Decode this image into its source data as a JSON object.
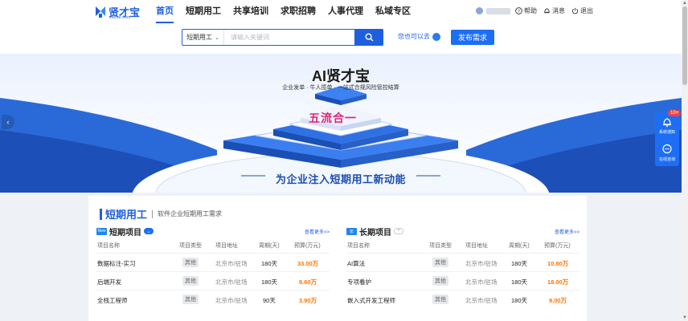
{
  "brand": {
    "name": "贤才宝",
    "domain": "xiecai.com",
    "primary": "#1e5fe0",
    "price_color": "#ff7300"
  },
  "nav": [
    {
      "label": "首页",
      "active": true
    },
    {
      "label": "短期用工"
    },
    {
      "label": "共享培训"
    },
    {
      "label": "求职招聘"
    },
    {
      "label": "人事代理"
    },
    {
      "label": "私域专区"
    }
  ],
  "user_menu": {
    "help": "帮助",
    "messages": "消息",
    "logout": "退出"
  },
  "search": {
    "category": "短期用工",
    "placeholder": "请输入关键词",
    "ask_label": "您也可以去",
    "publish_label": "发布需求"
  },
  "banner": {
    "title": "AI贤才宝",
    "subtitle": "企业发单 · 牛人揽单 · 一站式合规风险管控结算",
    "center_text": "五流合一",
    "slogan": "为企业注入短期用工新动能"
  },
  "side_float": {
    "badge": "10+",
    "notify_label": "系统通知",
    "consult_label": "在线咨询"
  },
  "section": {
    "title": "短期用工",
    "desc": "软件企业短期用工需求",
    "short": {
      "badge": "New",
      "title": "短期项目",
      "more": "查看更多>>",
      "headers": [
        "项目名称",
        "项目类型",
        "项目地址",
        "周期(天)",
        "预算(万元)"
      ],
      "rows": [
        {
          "name": "数据标注-实习",
          "type": "其他",
          "location": "北京市/驻场",
          "period": "180天",
          "budget": "33.00万"
        },
        {
          "name": "后端开发",
          "type": "其他",
          "location": "北京市/驻场",
          "period": "180天",
          "budget": "9.60万"
        },
        {
          "name": "全栈工程师",
          "type": "其他",
          "location": "北京市/驻场",
          "period": "90天",
          "budget": "3.90万"
        }
      ]
    },
    "long": {
      "badge": "长",
      "title": "长期项目",
      "more": "查看更多>>",
      "headers": [
        "项目名称",
        "项目类型",
        "项目地址",
        "周期(天)",
        "预算(万元)"
      ],
      "rows": [
        {
          "name": "AI算法",
          "type": "其他",
          "location": "北京市/驻场",
          "period": "180天",
          "budget": "10.80万"
        },
        {
          "name": "专项看护",
          "type": "其他",
          "location": "北京市/驻场",
          "period": "180天",
          "budget": "18.00万"
        },
        {
          "name": "嵌入式开发工程师",
          "type": "其他",
          "location": "北京市/驻场",
          "period": "180天",
          "budget": "9.00万"
        }
      ]
    }
  }
}
